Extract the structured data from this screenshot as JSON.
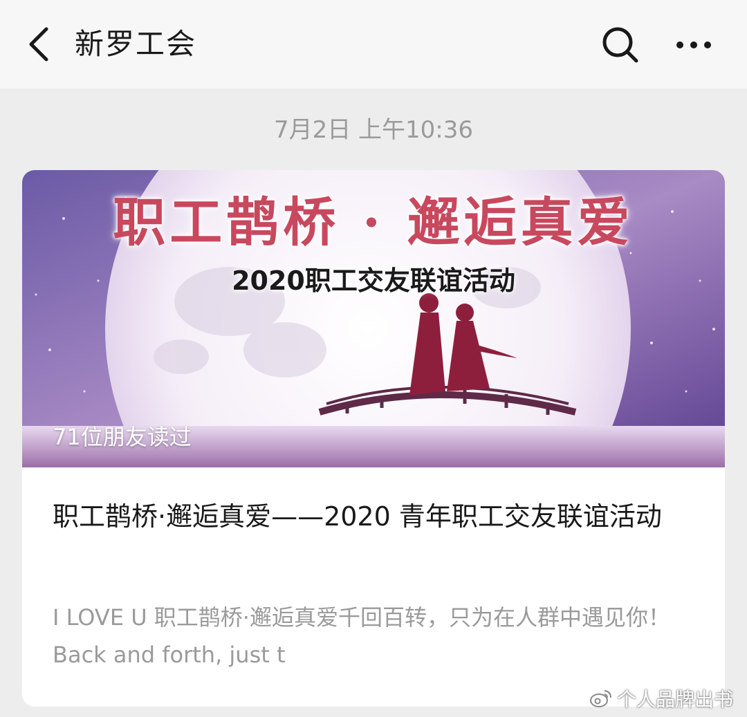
{
  "header": {
    "title": "新罗工会",
    "back_icon": "chevron-left-icon",
    "search_icon": "search-icon",
    "more_icon": "more-icon"
  },
  "message": {
    "timestamp": "7月2日 上午10:36"
  },
  "article_card": {
    "cover": {
      "heading": "职工鹊桥 · 邂逅真爱",
      "subheading": "2020职工交友联谊活动",
      "read_count": "71位朋友读过"
    },
    "title": "职工鹊桥·邂逅真爱——2020 青年职工交友联谊活动",
    "summary": "I LOVE U 职工鹊桥·邂逅真爱千回百转，只为在人群中遇见你！Back and forth, just t"
  },
  "watermark": {
    "text": "个人品牌出书",
    "icon": "weibo-icon"
  },
  "colors": {
    "topbar_bg": "#f7f7f7",
    "page_bg": "#ededed",
    "heading_pink": "#c8485e",
    "silhouette": "#8e1f3c"
  }
}
